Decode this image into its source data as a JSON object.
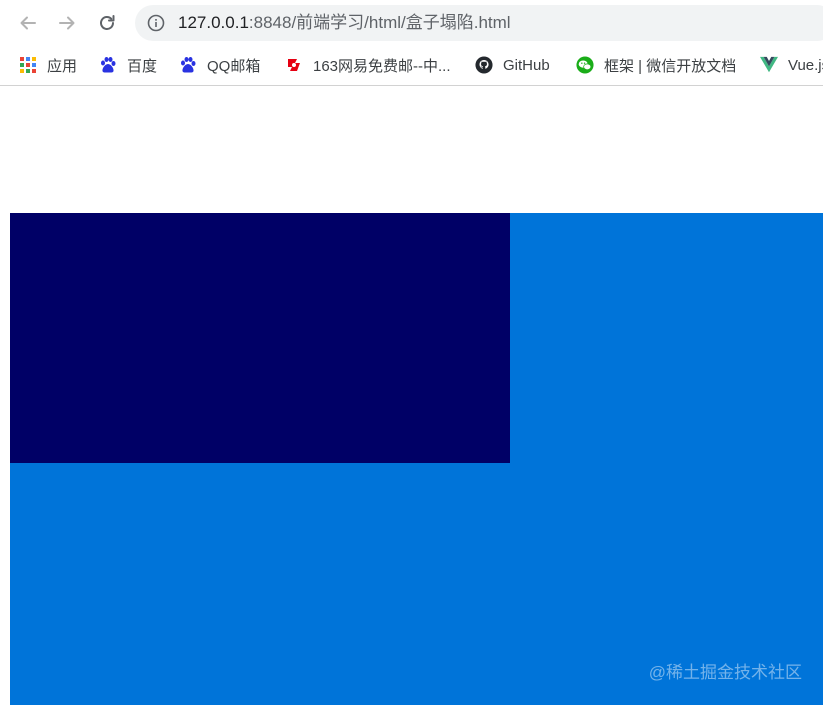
{
  "toolbar": {
    "back_icon": "arrow-left-icon",
    "forward_icon": "arrow-right-icon",
    "reload_icon": "reload-icon",
    "info_icon": "info-icon",
    "url_host": "127.0.0.1",
    "url_rest": ":8848/前端学习/html/盒子塌陷.html"
  },
  "bookmarks": {
    "items": [
      {
        "label": "应用",
        "icon": "apps-grid-icon"
      },
      {
        "label": "百度",
        "icon": "baidu-paw-icon"
      },
      {
        "label": "QQ邮箱",
        "icon": "baidu-paw-icon"
      },
      {
        "label": "163网易免费邮--中...",
        "icon": "netease-163-icon"
      },
      {
        "label": "GitHub",
        "icon": "github-icon"
      },
      {
        "label": "框架 | 微信开放文档",
        "icon": "wechat-icon"
      },
      {
        "label": "Vue.js",
        "icon": "vue-icon"
      }
    ]
  },
  "page": {
    "parent_color": "#0074d9",
    "child_color": "#000066",
    "watermark": "@稀土掘金技术社区"
  }
}
